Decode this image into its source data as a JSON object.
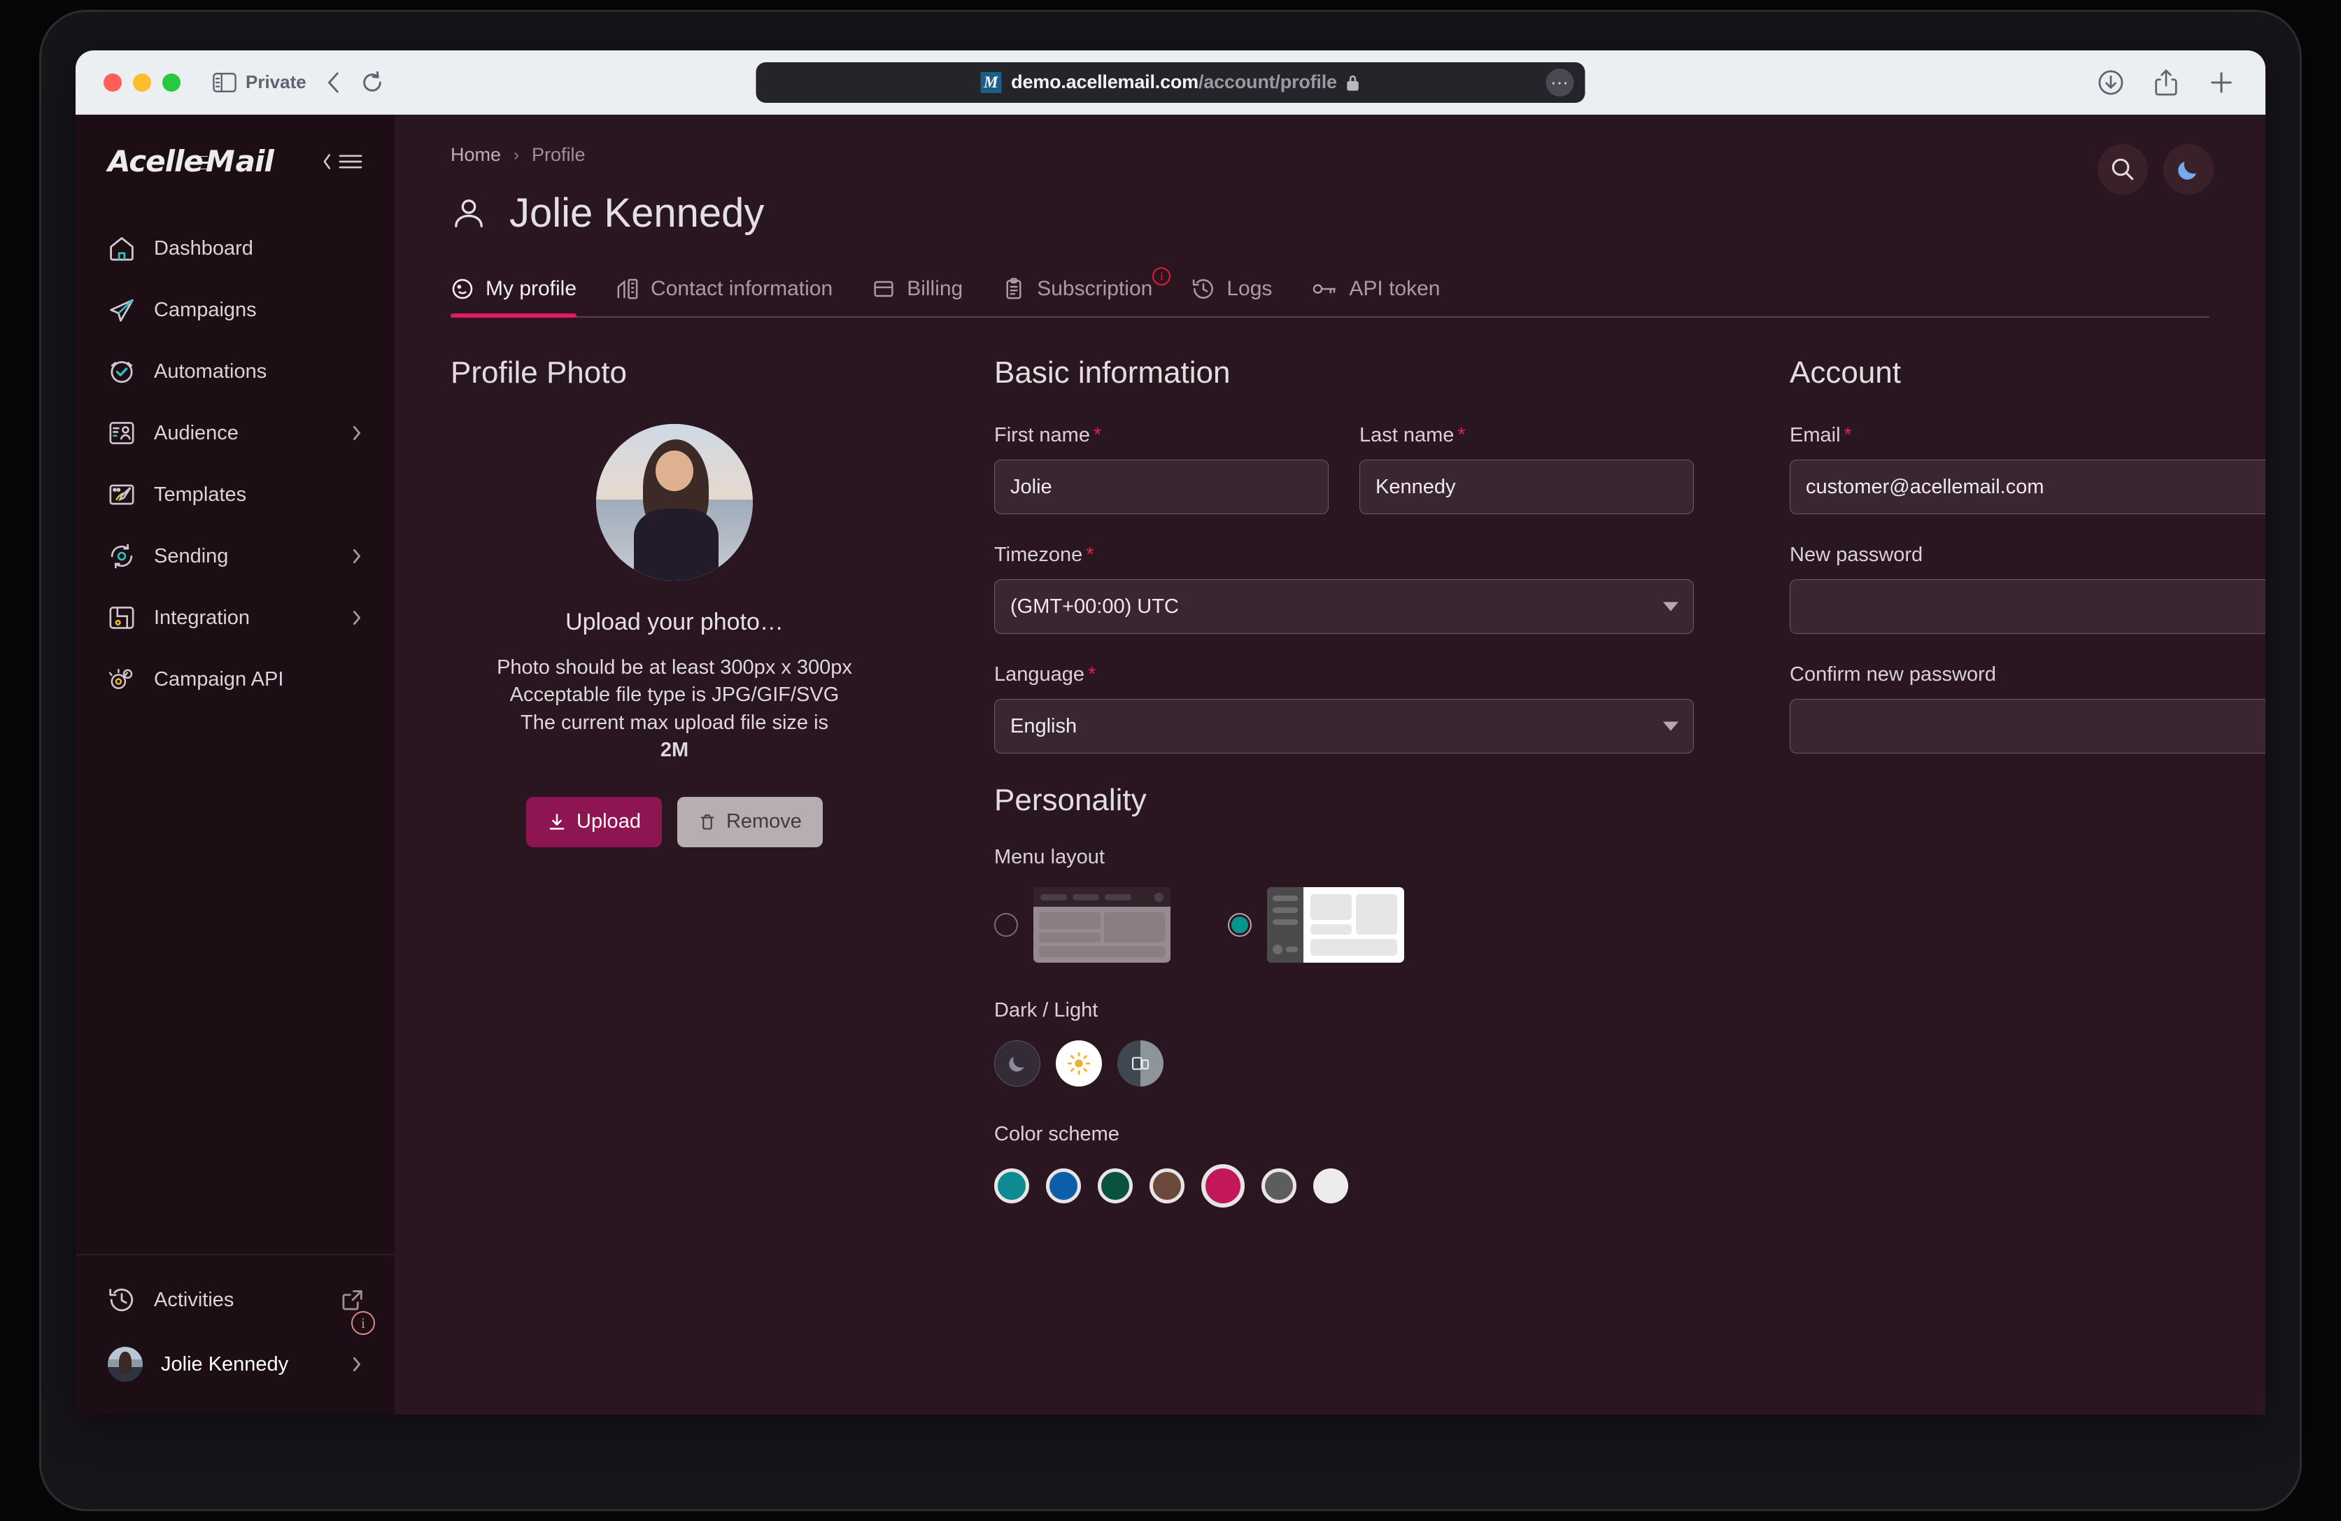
{
  "browser": {
    "private_label": "Private",
    "url_host": "demo.acellemail.com",
    "url_path": "/account/profile",
    "favicon_letter": "M"
  },
  "sidebar": {
    "brand_prefix": "Acelle",
    "brand_suffix": "ail",
    "items": [
      {
        "label": "Dashboard",
        "icon": "home-icon",
        "chevron": false
      },
      {
        "label": "Campaigns",
        "icon": "paper-plane-icon",
        "chevron": false
      },
      {
        "label": "Automations",
        "icon": "check-circle-icon",
        "chevron": false
      },
      {
        "label": "Audience",
        "icon": "audience-icon",
        "chevron": true
      },
      {
        "label": "Templates",
        "icon": "brush-icon",
        "chevron": false
      },
      {
        "label": "Sending",
        "icon": "sync-gear-icon",
        "chevron": true
      },
      {
        "label": "Integration",
        "icon": "plug-icon",
        "chevron": true
      },
      {
        "label": "Campaign API",
        "icon": "api-gear-icon",
        "chevron": false
      }
    ],
    "footer": {
      "activities_label": "Activities",
      "user_label": "Jolie Kennedy",
      "info_badge": "i"
    }
  },
  "header": {
    "breadcrumb_home": "Home",
    "breadcrumb_sep": "›",
    "breadcrumb_current": "Profile",
    "page_title": "Jolie Kennedy"
  },
  "tabs": [
    {
      "label": "My profile",
      "icon": "profile-icon",
      "active": true,
      "badge": null
    },
    {
      "label": "Contact information",
      "icon": "building-icon",
      "active": false,
      "badge": null
    },
    {
      "label": "Billing",
      "icon": "card-icon",
      "active": false,
      "badge": null
    },
    {
      "label": "Subscription",
      "icon": "clipboard-icon",
      "active": false,
      "badge": "i"
    },
    {
      "label": "Logs",
      "icon": "history-icon",
      "active": false,
      "badge": null
    },
    {
      "label": "API token",
      "icon": "key-icon",
      "active": false,
      "badge": null
    }
  ],
  "profile_photo": {
    "heading": "Profile Photo",
    "upload_title": "Upload your photo…",
    "note_line1": "Photo should be at least 300px x 300px",
    "note_line2": "Acceptable file type is JPG/GIF/SVG",
    "note_line3": "The current max upload file size is",
    "max_size": "2M",
    "upload_button": "Upload",
    "remove_button": "Remove"
  },
  "basic_information": {
    "heading": "Basic information",
    "first_name_label": "First name",
    "first_name_value": "Jolie",
    "last_name_label": "Last name",
    "last_name_value": "Kennedy",
    "timezone_label": "Timezone",
    "timezone_value": "(GMT+00:00) UTC",
    "language_label": "Language",
    "language_value": "English",
    "required_mark": "*"
  },
  "account": {
    "heading": "Account",
    "email_label": "Email",
    "email_value": "customer@acellemail.com",
    "new_password_label": "New password",
    "new_password_value": "",
    "confirm_password_label": "Confirm new password",
    "confirm_password_value": ""
  },
  "personality": {
    "heading": "Personality",
    "menu_layout_label": "Menu layout",
    "menu_layout_options": [
      {
        "name": "top-navigation",
        "selected": false
      },
      {
        "name": "side-navigation",
        "selected": true
      }
    ],
    "dark_light_label": "Dark / Light",
    "modes": [
      {
        "name": "dark",
        "icon": "moon-icon",
        "selected": false
      },
      {
        "name": "light",
        "icon": "sun-icon",
        "selected": true
      },
      {
        "name": "system",
        "icon": "system-icon",
        "selected": false
      }
    ],
    "color_scheme_label": "Color scheme",
    "colors": [
      {
        "hex": "#0d8b91",
        "selected": false
      },
      {
        "hex": "#0b5fa8",
        "selected": false
      },
      {
        "hex": "#0a5240",
        "selected": false
      },
      {
        "hex": "#6b4a3c",
        "selected": false
      },
      {
        "hex": "#c2185b",
        "selected": true
      },
      {
        "hex": "#5d5d5d",
        "selected": false
      },
      {
        "hex": "#ececec",
        "selected": false
      }
    ]
  },
  "theme": {
    "accent": "#e01b62",
    "sidebar_bg": "#1d0d14",
    "main_bg": "#2a1620",
    "teal": "#06958e"
  }
}
